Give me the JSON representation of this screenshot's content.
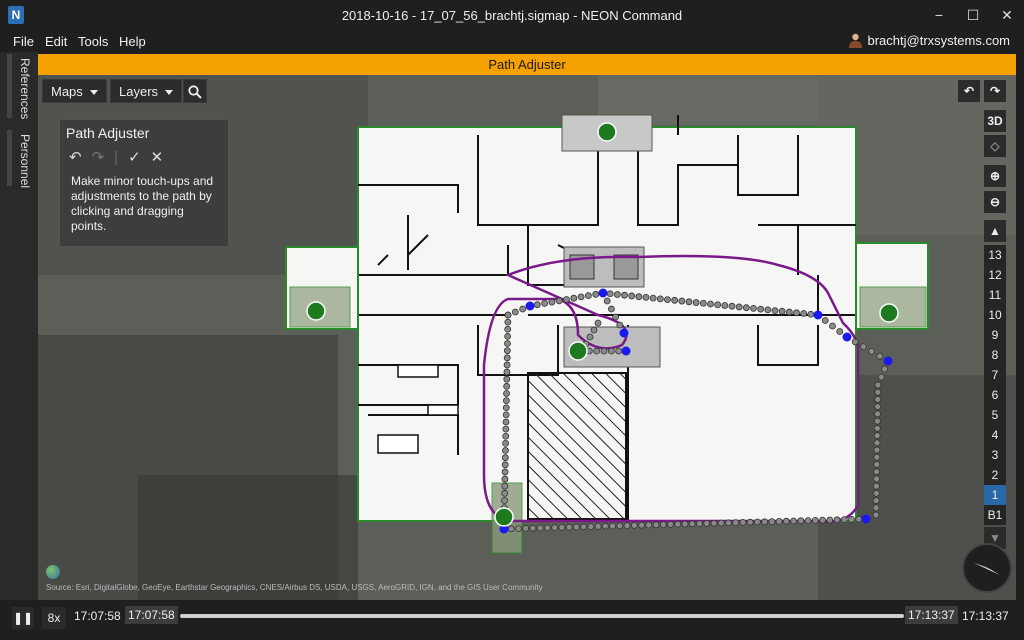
{
  "window": {
    "title": "2018-10-16 - 17_07_56_brachtj.sigmap - NEON Command",
    "logo_letter": "N",
    "minimize": "−",
    "maximize": "☐",
    "close": "✕"
  },
  "menu": {
    "items": [
      "File",
      "Edit",
      "Tools",
      "Help"
    ],
    "user": "brachtj@trxsystems.com"
  },
  "banner": {
    "label": "Path Adjuster"
  },
  "left_rail": {
    "tabs": [
      "References",
      "Personnel"
    ]
  },
  "map_toolbar": {
    "maps_label": "Maps",
    "layers_label": "Layers"
  },
  "path_panel": {
    "title": "Path Adjuster",
    "description": "Make minor touch-ups and adjustments to the path by clicking and dragging points."
  },
  "right_controls": {
    "view_3d": "3D",
    "floors": [
      "13",
      "12",
      "11",
      "10",
      "9",
      "8",
      "7",
      "6",
      "5",
      "4",
      "3",
      "2",
      "1",
      "B1"
    ],
    "active_floor": "1"
  },
  "attribution": "Source: Esri, DigitalGlobe, GeoEye, Earthstar Geographics, CNES/Airbus DS, USDA, USGS, AeroGRID, IGN, and the GIS User Community",
  "playback": {
    "speed": "8x",
    "start_time": "17:07:58",
    "current_start": "17:07:58",
    "current_end": "17:13:37",
    "end_time": "17:13:37"
  },
  "colors": {
    "accent_orange": "#f5a100",
    "floor_outline": "#2a8a2a",
    "path_purple": "#7a1a8a",
    "path_points": "#8a8a8a",
    "control_points": "#1a1aee",
    "active_floor": "#2a67a8"
  }
}
